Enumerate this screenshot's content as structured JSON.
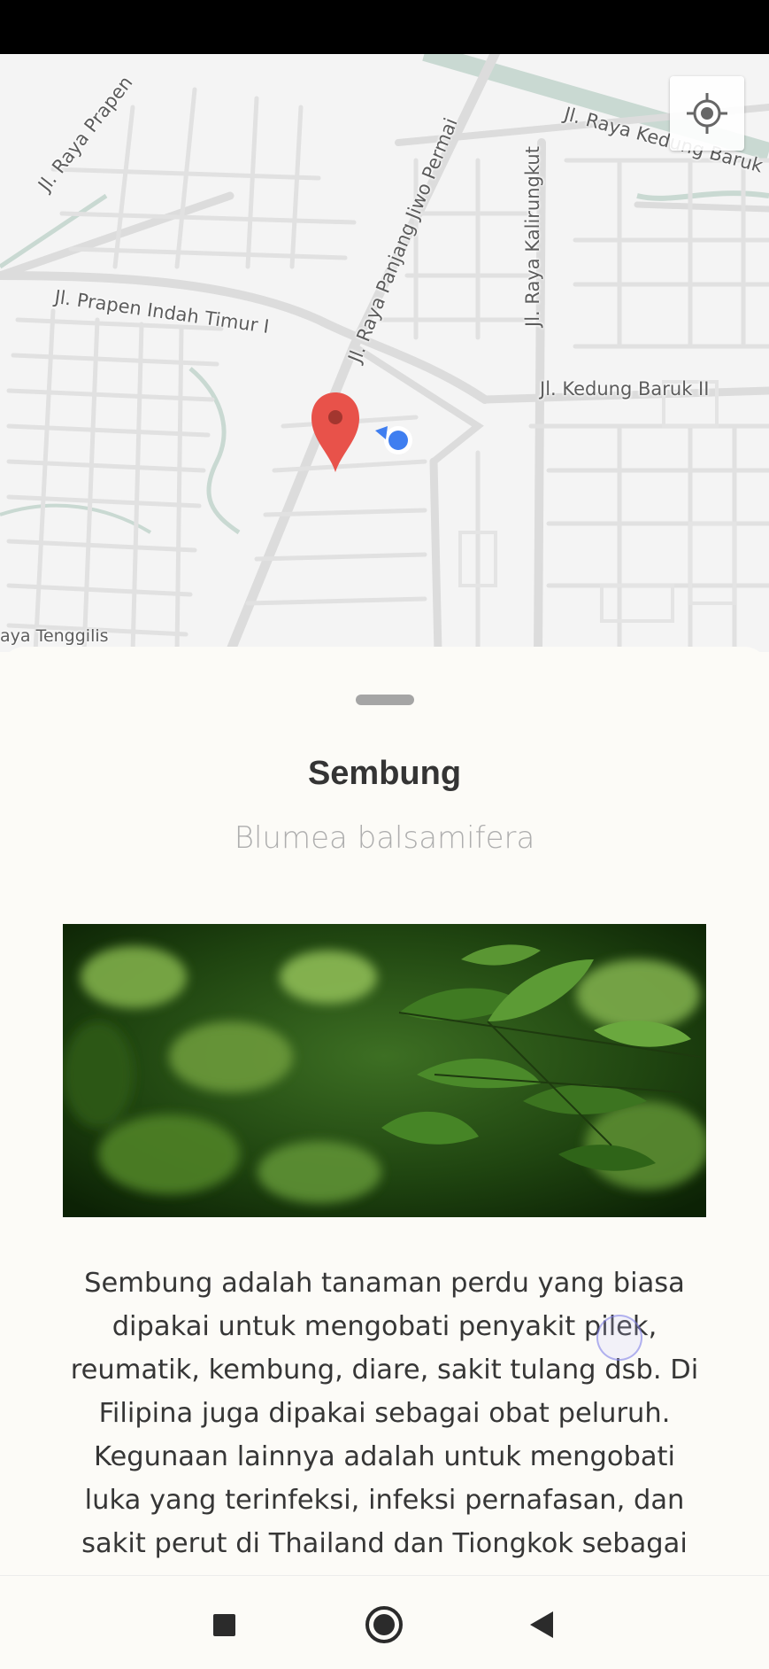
{
  "map": {
    "road_labels": [
      "Jl. Raya Prapen",
      "Jl. Raya Kedung Baruk",
      "Jl. Raya Panjang Jiwo Permai",
      "Jl. Raya Kalirungkut",
      "Jl. Prapen Indah Timur I",
      "Jl. Kedung Baruk II",
      "aya Tenggilis"
    ],
    "marker_color": "#e8524a",
    "user_dot_color": "#3f7ef0",
    "locate_icon": "my-location-icon"
  },
  "plant": {
    "name": "Sembung",
    "latin_name": "Blumea balsamifera",
    "description": "Sembung adalah tanaman perdu yang biasa dipakai untuk mengobati penyakit pilek, reumatik, kembung, diare, sakit tulang dsb. Di Filipina juga dipakai sebagai obat peluruh. Kegunaan lainnya adalah untuk mengobati luka yang terinfeksi, infeksi pernafasan, dan sakit perut di Thailand dan Tiongkok sebagai obat"
  },
  "nav": {
    "recents_icon": "square-icon",
    "home_icon": "circle-icon",
    "back_icon": "triangle-back-icon"
  }
}
